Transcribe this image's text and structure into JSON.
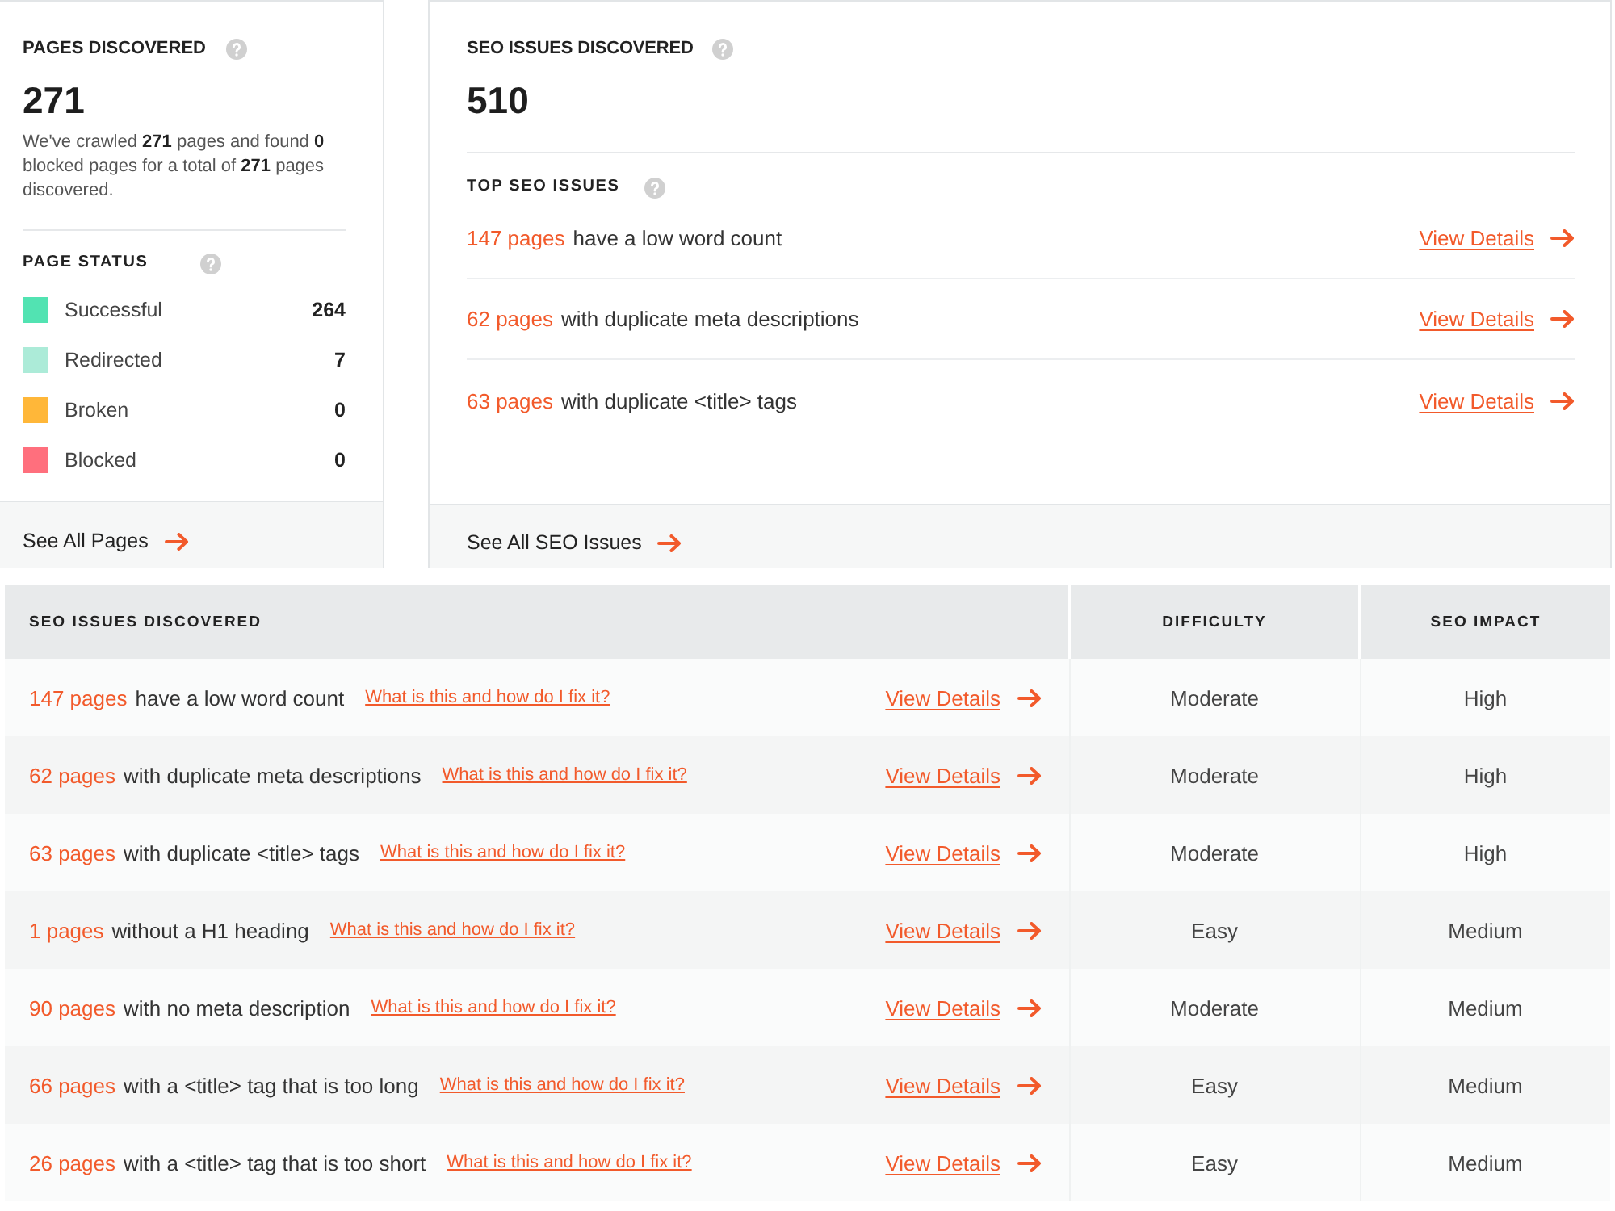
{
  "pages_panel": {
    "title": "PAGES DISCOVERED",
    "count": "271",
    "summary": "We've crawled **271** pages and found **0** blocked pages for a total of **271** pages discovered.",
    "status_title": "PAGE STATUS",
    "statuses": [
      {
        "label": "Successful",
        "count": "264",
        "color": "#52e3b2"
      },
      {
        "label": "Redirected",
        "count": "7",
        "color": "#acebd8"
      },
      {
        "label": "Broken",
        "count": "0",
        "color": "#ffb739"
      },
      {
        "label": "Blocked",
        "count": "0",
        "color": "#ff6f7d"
      }
    ],
    "footer_link": "See All Pages"
  },
  "seo_panel": {
    "title": "SEO ISSUES DISCOVERED",
    "count": "510",
    "top_title": "TOP SEO ISSUES",
    "top_issues": [
      {
        "pages": "147 pages",
        "text": "have a low word count",
        "link": "View Details"
      },
      {
        "pages": "62 pages",
        "text": "with duplicate meta descriptions",
        "link": "View Details"
      },
      {
        "pages": "63 pages",
        "text": "with duplicate <title> tags",
        "link": "View Details"
      }
    ],
    "footer_link": "See All SEO Issues"
  },
  "issues_table": {
    "columns": [
      "SEO ISSUES DISCOVERED",
      "DIFFICULTY",
      "SEO IMPACT"
    ],
    "rows": [
      {
        "pages": "147 pages",
        "text": "have a low word count",
        "help_link": "What is this and how do I fix it?",
        "details_link": "View Details",
        "difficulty": "Moderate",
        "impact": "High"
      },
      {
        "pages": "62 pages",
        "text": "with duplicate meta descriptions",
        "help_link": "What is this and how do I fix it?",
        "details_link": "View Details",
        "difficulty": "Moderate",
        "impact": "High"
      },
      {
        "pages": "63 pages",
        "text": "with duplicate <title> tags",
        "help_link": "What is this and how do I fix it?",
        "details_link": "View Details",
        "difficulty": "Moderate",
        "impact": "High"
      },
      {
        "pages": "1 pages",
        "text": "without a H1 heading",
        "help_link": "What is this and how do I fix it?",
        "details_link": "View Details",
        "difficulty": "Easy",
        "impact": "Medium"
      },
      {
        "pages": "90 pages",
        "text": "with no meta description",
        "help_link": "What is this and how do I fix it?",
        "details_link": "View Details",
        "difficulty": "Moderate",
        "impact": "Medium"
      },
      {
        "pages": "66 pages",
        "text": "with a <title> tag that is too long",
        "help_link": "What is this and how do I fix it?",
        "details_link": "View Details",
        "difficulty": "Easy",
        "impact": "Medium"
      },
      {
        "pages": "26 pages",
        "text": "with a <title> tag that is too short",
        "help_link": "What is this and how do I fix it?",
        "details_link": "View Details",
        "difficulty": "Easy",
        "impact": "Medium"
      }
    ]
  }
}
